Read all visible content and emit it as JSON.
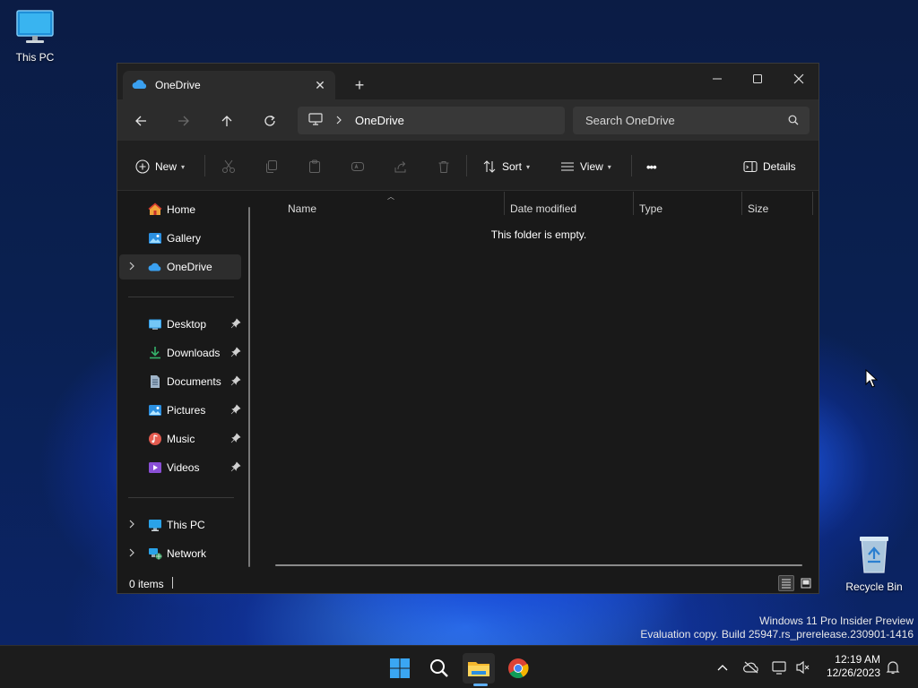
{
  "desktop": {
    "icons": [
      {
        "label": "This PC",
        "icon": "monitor-icon"
      },
      {
        "label": "Recycle Bin",
        "icon": "recycle-bin-icon"
      }
    ],
    "watermark": {
      "line1": "Windows 11 Pro Insider Preview",
      "line2": "Evaluation copy. Build 25947.rs_prerelease.230901-1416"
    }
  },
  "window": {
    "tab": {
      "title": "OneDrive",
      "icon": "onedrive-cloud-icon",
      "close": "✕"
    },
    "new_tab": "+",
    "controls": [
      "minimize",
      "maximize",
      "close"
    ],
    "address": {
      "root_icon": "this-pc-icon",
      "crumbs": [
        "OneDrive"
      ]
    },
    "search": {
      "placeholder": "Search OneDrive"
    },
    "toolbar": {
      "new_label": "New",
      "sort_label": "Sort",
      "view_label": "View",
      "more_label": "•••",
      "details_label": "Details",
      "disabled_actions": [
        "cut",
        "copy",
        "paste",
        "rename",
        "share",
        "delete"
      ]
    },
    "sidebar": {
      "quick": [
        {
          "label": "Home",
          "icon": "home-icon"
        },
        {
          "label": "Gallery",
          "icon": "gallery-icon"
        },
        {
          "label": "OneDrive",
          "icon": "onedrive-cloud-icon",
          "selected": true,
          "expandable": true
        }
      ],
      "pinned": [
        {
          "label": "Desktop",
          "icon": "desktop-folder-icon"
        },
        {
          "label": "Downloads",
          "icon": "downloads-icon"
        },
        {
          "label": "Documents",
          "icon": "documents-icon"
        },
        {
          "label": "Pictures",
          "icon": "pictures-icon"
        },
        {
          "label": "Music",
          "icon": "music-icon"
        },
        {
          "label": "Videos",
          "icon": "videos-icon"
        }
      ],
      "locations": [
        {
          "label": "This PC",
          "icon": "this-pc-icon",
          "expandable": true
        },
        {
          "label": "Network",
          "icon": "network-icon",
          "expandable": true
        }
      ]
    },
    "columns": [
      "Name",
      "Date modified",
      "Type",
      "Size"
    ],
    "empty_message": "This folder is empty.",
    "status": {
      "items_text": "0 items"
    }
  },
  "taskbar": {
    "apps": [
      "start-icon",
      "search-icon",
      "file-explorer-icon",
      "chrome-icon"
    ],
    "active_app": "file-explorer-icon",
    "tray": [
      "chevron-up-icon",
      "onedrive-offline-icon",
      "network-display-icon",
      "volume-muted-icon"
    ],
    "time": "12:19 AM",
    "date": "12/26/2023"
  },
  "colors": {
    "accent": "#60b0f4",
    "window_bg": "#191919",
    "toolbar_bg": "#202020"
  }
}
